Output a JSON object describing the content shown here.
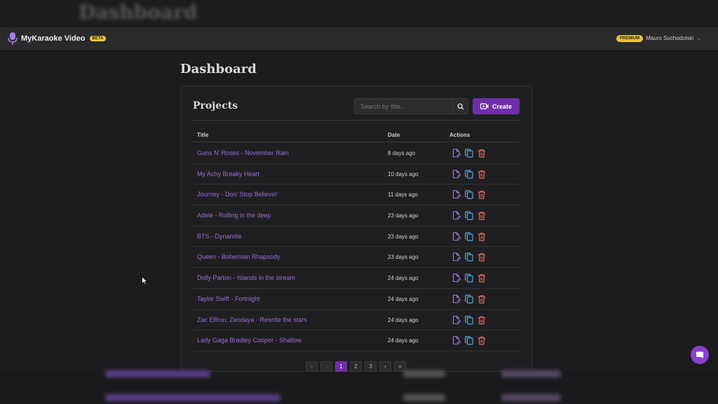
{
  "app": {
    "name": "MyKaraoke Video",
    "badge": "BETA"
  },
  "ghost_title": "Dashboard",
  "user": {
    "badge": "PREMIUM",
    "name": "Mauro Suchodolski"
  },
  "page_title": "Dashboard",
  "projects": {
    "title": "Projects",
    "search_placeholder": "Search by title...",
    "create_label": "Create",
    "columns": {
      "title": "Title",
      "date": "Date",
      "actions": "Actions"
    },
    "rows": [
      {
        "title": "Guns N' Roses - November Rain",
        "date": "8 days ago"
      },
      {
        "title": "My Achy Breaky Heart",
        "date": "10 days ago"
      },
      {
        "title": "Journey - Don' Stop Believin'",
        "date": "11 days ago"
      },
      {
        "title": "Adele - Rolling in the deep",
        "date": "23 days ago"
      },
      {
        "title": "BTS - Dynamite",
        "date": "23 days ago"
      },
      {
        "title": "Queen - Bohemian Rhapsody",
        "date": "23 days ago"
      },
      {
        "title": "Dolly Parton - Islands in the stream",
        "date": "24 days ago"
      },
      {
        "title": "Taylor Swift - Fortnight",
        "date": "24 days ago"
      },
      {
        "title": "Zac Effron, Zendaya - Rewrite the stars",
        "date": "24 days ago"
      },
      {
        "title": "Lady Gaga Bradley Cooper - Shallow",
        "date": "24 days ago"
      }
    ]
  },
  "pagination": {
    "first": "«",
    "prev": "‹",
    "pages": [
      "1",
      "2",
      "3"
    ],
    "current": "1",
    "next": "›",
    "last": "»"
  },
  "colors": {
    "accent": "#6f2ea8",
    "link": "#9a6fd6",
    "premium": "#e8c341",
    "edit_icon": "#a87be0",
    "copy_icon": "#5aa9e6",
    "delete_icon": "#e06a6a"
  }
}
